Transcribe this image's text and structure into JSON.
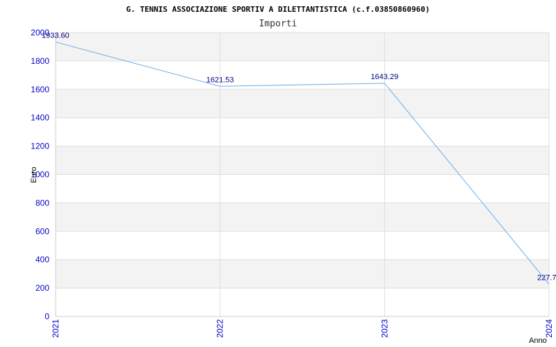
{
  "chart_data": {
    "type": "line",
    "title": "G. TENNIS ASSOCIAZIONE SPORTIV A DILETTANTISTICA (c.f.03850860960)",
    "subtitle": "Importi",
    "xlabel": "Anno",
    "ylabel": "Euro",
    "categories": [
      "2021",
      "2022",
      "2023",
      "2024"
    ],
    "series": [
      {
        "values": [
          1933.6,
          1621.53,
          1643.29,
          227.7
        ],
        "labels": [
          "1933.60",
          "1621.53",
          "1643.29",
          "227.7"
        ],
        "color": "#6aaee8"
      }
    ],
    "ylim": [
      0,
      2000
    ],
    "yticks": [
      0,
      200,
      400,
      600,
      800,
      1000,
      1200,
      1400,
      1600,
      1800,
      2000
    ],
    "grid": true,
    "band_colors": [
      "#ffffff",
      "#f3f3f3"
    ],
    "axis_color": "#0000cc"
  }
}
